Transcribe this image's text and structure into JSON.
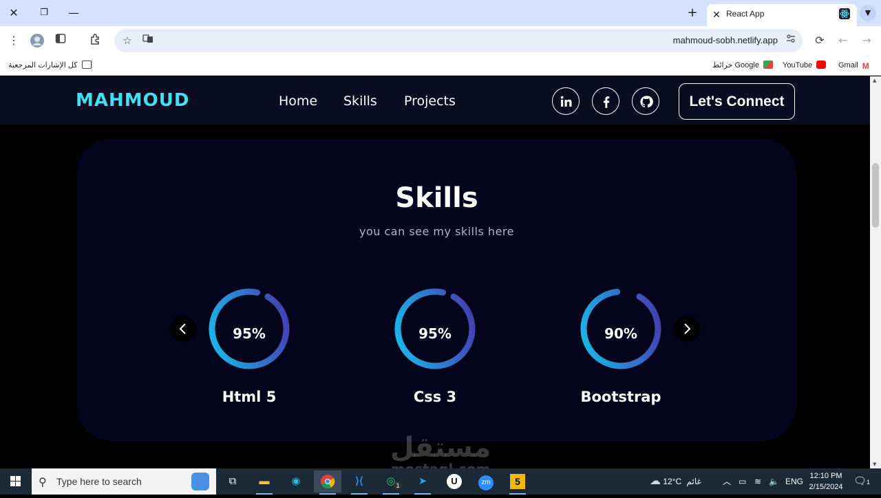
{
  "browser": {
    "tab_title": "React App",
    "url": "mahmoud-sobh.netlify.app",
    "bookmarks": {
      "all_bookmarks": "كل الإشارات المرجعية",
      "google_maps": "خرائط Google",
      "youtube": "YouTube",
      "gmail": "Gmail"
    }
  },
  "navbar": {
    "logo": "MAHMOUD",
    "links": [
      "Home",
      "Skills",
      "Projects"
    ],
    "social": [
      "linkedin-icon",
      "facebook-icon",
      "github-icon"
    ],
    "connect_label": "Let's Connect"
  },
  "skills": {
    "title": "Skills",
    "subtitle": "you can see my skills here",
    "items": [
      {
        "name": "Html 5",
        "percent_label": "95%",
        "percent": 95
      },
      {
        "name": "Css 3",
        "percent_label": "95%",
        "percent": 95
      },
      {
        "name": "Bootstrap",
        "percent_label": "90%",
        "percent": 90
      }
    ]
  },
  "watermark": {
    "arabic": "مستقل",
    "latin": "mostaql.com"
  },
  "taskbar": {
    "search_placeholder": "Type here to search",
    "weather_temp": "12°C",
    "weather_label": "غائم",
    "lang": "ENG",
    "time": "12:10 PM",
    "date": "2/15/2024",
    "notifications": "1",
    "whatsapp_badge": "1"
  },
  "colors": {
    "accent": "#3fe0f0",
    "ring_start": "#15c6f0",
    "ring_end": "#4b2ea8"
  }
}
